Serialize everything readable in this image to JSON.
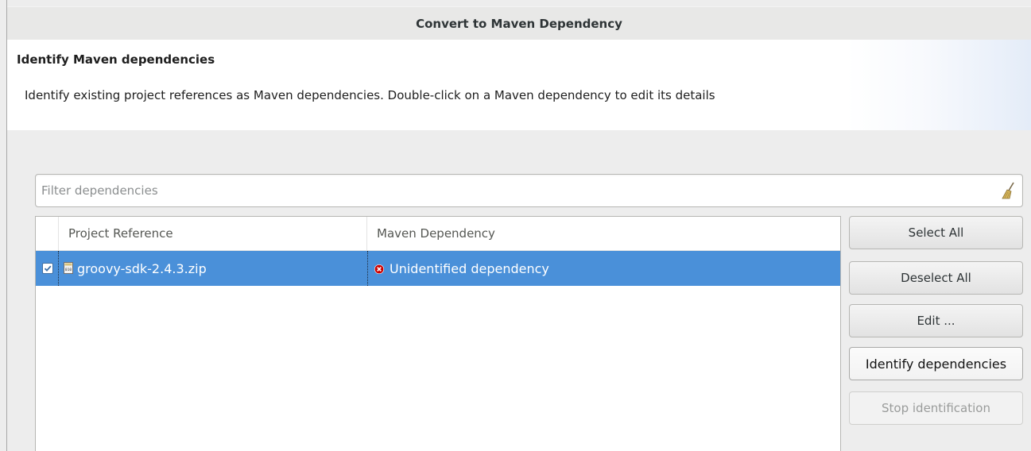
{
  "window": {
    "title": "Convert to Maven Dependency"
  },
  "header": {
    "title": "Identify Maven dependencies",
    "description": "Identify existing project references as Maven dependencies. Double-click on a Maven dependency to edit its details"
  },
  "filter": {
    "placeholder": "Filter dependencies",
    "value": "",
    "clear_icon": "broom-icon"
  },
  "table": {
    "columns": {
      "project_reference": "Project Reference",
      "maven_dependency": "Maven Dependency"
    },
    "rows": [
      {
        "checked": true,
        "selected": true,
        "project_reference": "groovy-sdk-2.4.3.zip",
        "reference_icon": "binary-archive-icon",
        "maven_dependency": "Unidentified dependency",
        "dependency_icon": "error-icon"
      }
    ]
  },
  "buttons": {
    "select_all": "Select All",
    "deselect_all": "Deselect All",
    "edit": "Edit ...",
    "identify": "Identify dependencies",
    "stop": "Stop identification"
  },
  "colors": {
    "selection": "#4a90d9",
    "error": "#cc0000"
  }
}
